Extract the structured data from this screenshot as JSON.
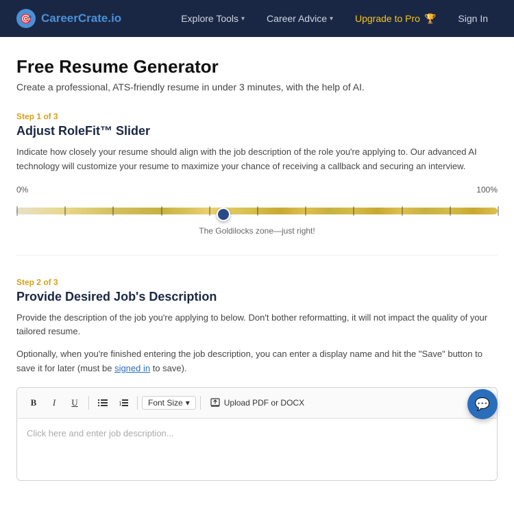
{
  "brand": {
    "logo_icon": "🎯",
    "name_main": "CareerCrate",
    "name_ext": ".io"
  },
  "nav": {
    "explore_tools": "Explore Tools",
    "career_advice": "Career Advice",
    "upgrade": "Upgrade to Pro",
    "upgrade_icon": "🏆",
    "signin": "Sign In"
  },
  "page": {
    "title": "Free Resume Generator",
    "subtitle": "Create a professional, ATS-friendly resume in under 3 minutes, with the help of AI."
  },
  "step1": {
    "label": "Step 1 of 3",
    "title": "Adjust RoleFit™ Slider",
    "description": "Indicate how closely your resume should align with the job description of the role you're applying to. Our advanced AI technology will customize your resume to maximize your chance of receiving a callback and securing an interview.",
    "slider_min": "0%",
    "slider_max": "100%",
    "slider_value": 43,
    "goldilocks_label": "The Goldilocks zone—just right!"
  },
  "step2": {
    "label": "Step 2 of 3",
    "title": "Provide Desired Job's Description",
    "description": "Provide the description of the job you're applying to below. Don't bother reformatting, it will not impact the quality of your tailored resume.",
    "optional_text_before": "Optionally, when you're finished entering the job description, you can enter a display name and hit the \"Save\" button to save it for later (must be ",
    "optional_link": "signed in",
    "optional_text_after": " to save).",
    "toolbar": {
      "bold": "B",
      "italic": "I",
      "underline": "U",
      "list_unordered": "≡",
      "list_ordered": "≣",
      "font_size": "Font Size",
      "upload": "Upload PDF or DOCX"
    },
    "editor_placeholder": "Click here and enter job description..."
  }
}
